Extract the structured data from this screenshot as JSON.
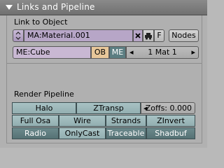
{
  "panel": {
    "title": "Links and Pipeline"
  },
  "link": {
    "section_label": "Link to Object",
    "material_field": "MA:Material.001",
    "f_button": "F",
    "nodes_button": "Nodes",
    "mesh_field": "ME:Cube",
    "ob_button": "OB",
    "me_button": "ME",
    "mat_counter": "1 Mat 1",
    "browse_icon": "double-arrow-icon",
    "delete_icon": "x-icon",
    "car_icon": "car-icon"
  },
  "pipeline": {
    "section_label": "Render Pipeline",
    "rows": [
      [
        "Halo",
        "ZTransp",
        "Zoffs: 0.000"
      ],
      [
        "Full Osa",
        "Wire",
        "Strands",
        "ZInvert"
      ],
      [
        "Radio",
        "OnlyCast",
        "Traceable",
        "Shadbuf"
      ]
    ]
  },
  "colors": {
    "header": "#7a7a7a",
    "panel": "#b1b1b1",
    "toggle_off": "#9ab5b7",
    "toggle_on": "#5f7c7f",
    "field_material": "#b7a6c7",
    "field_mesh": "#c9b8d3",
    "ob_active": "#e8c79a",
    "me_active": "#5c7e82"
  }
}
